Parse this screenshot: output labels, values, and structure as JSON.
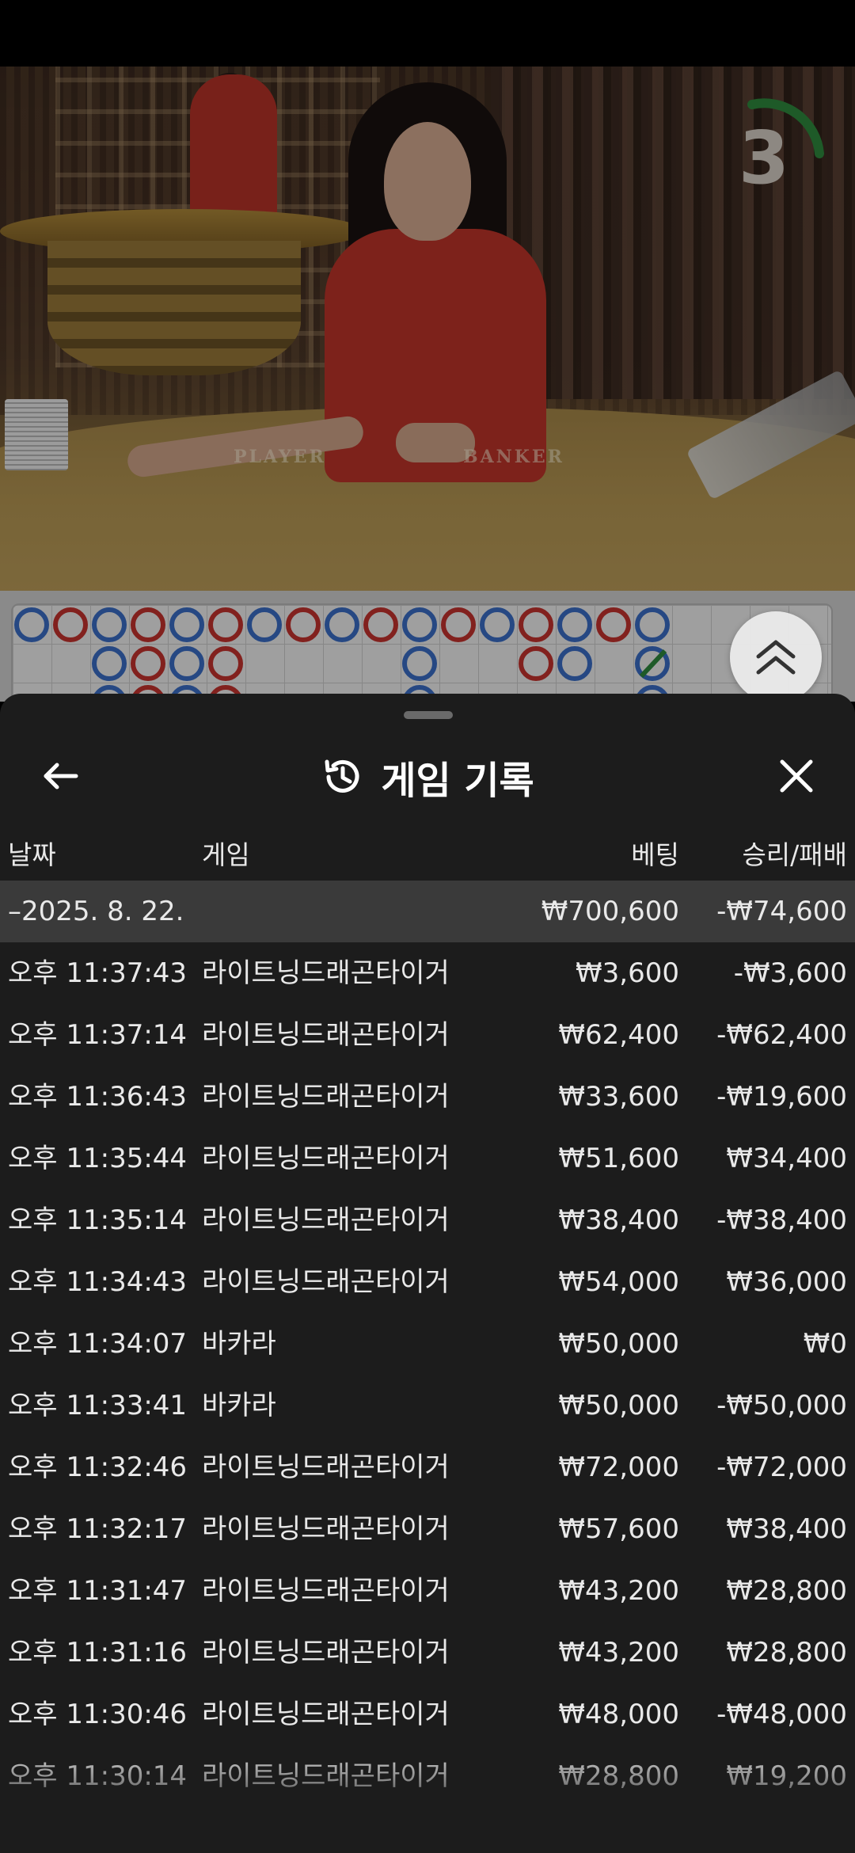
{
  "video": {
    "table_label_player": "PLAYER",
    "table_label_banker": "BANKER",
    "countdown": "3",
    "countdown_color": "#2e8b3e"
  },
  "roadmap": {
    "colors": {
      "player": "#3b6fc9",
      "banker": "#c8332f",
      "tie": "#2e8b3e"
    }
  },
  "sheet": {
    "title": "게임 기록",
    "icons": {
      "back": "arrow-left-icon",
      "history": "history-icon",
      "close": "close-icon",
      "expand": "chevron-double-up-icon"
    },
    "columns": {
      "date": "날짜",
      "game": "게임",
      "bet": "베팅",
      "result": "승리/패배"
    },
    "date_group": {
      "label": "–2025. 8. 22.",
      "bet": "₩700,600",
      "result": "-₩74,600"
    },
    "rows": [
      {
        "time": "오후 11:37:43",
        "game": "라이트닝드래곤타이거",
        "bet": "₩3,600",
        "result": "-₩3,600"
      },
      {
        "time": "오후 11:37:14",
        "game": "라이트닝드래곤타이거",
        "bet": "₩62,400",
        "result": "-₩62,400"
      },
      {
        "time": "오후 11:36:43",
        "game": "라이트닝드래곤타이거",
        "bet": "₩33,600",
        "result": "-₩19,600"
      },
      {
        "time": "오후 11:35:44",
        "game": "라이트닝드래곤타이거",
        "bet": "₩51,600",
        "result": "₩34,400"
      },
      {
        "time": "오후 11:35:14",
        "game": "라이트닝드래곤타이거",
        "bet": "₩38,400",
        "result": "-₩38,400"
      },
      {
        "time": "오후 11:34:43",
        "game": "라이트닝드래곤타이거",
        "bet": "₩54,000",
        "result": "₩36,000"
      },
      {
        "time": "오후 11:34:07",
        "game": "바카라",
        "bet": "₩50,000",
        "result": "₩0"
      },
      {
        "time": "오후 11:33:41",
        "game": "바카라",
        "bet": "₩50,000",
        "result": "-₩50,000"
      },
      {
        "time": "오후 11:32:46",
        "game": "라이트닝드래곤타이거",
        "bet": "₩72,000",
        "result": "-₩72,000"
      },
      {
        "time": "오후 11:32:17",
        "game": "라이트닝드래곤타이거",
        "bet": "₩57,600",
        "result": "₩38,400"
      },
      {
        "time": "오후 11:31:47",
        "game": "라이트닝드래곤타이거",
        "bet": "₩43,200",
        "result": "₩28,800"
      },
      {
        "time": "오후 11:31:16",
        "game": "라이트닝드래곤타이거",
        "bet": "₩43,200",
        "result": "₩28,800"
      },
      {
        "time": "오후 11:30:46",
        "game": "라이트닝드래곤타이거",
        "bet": "₩48,000",
        "result": "-₩48,000"
      },
      {
        "time": "오후 11:30:14",
        "game": "라이트닝드래곤타이거",
        "bet": "₩28,800",
        "result": "₩19,200"
      }
    ]
  }
}
